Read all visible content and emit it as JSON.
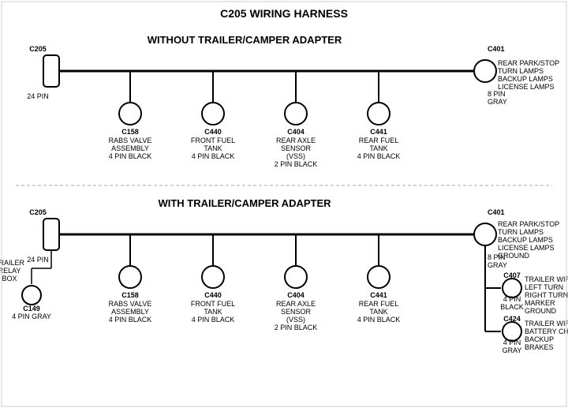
{
  "title": "C205 WIRING HARNESS",
  "section1": {
    "label": "WITHOUT TRAILER/CAMPER ADAPTER",
    "left_connector": {
      "name": "C205",
      "pins": "24 PIN"
    },
    "right_connector": {
      "name": "C401",
      "pins": "8 PIN",
      "color": "GRAY"
    },
    "right_labels": [
      "REAR PARK/STOP",
      "TURN LAMPS",
      "BACKUP LAMPS",
      "LICENSE LAMPS"
    ],
    "connectors": [
      {
        "name": "C158",
        "line1": "RABS VALVE",
        "line2": "ASSEMBLY",
        "line3": "4 PIN BLACK"
      },
      {
        "name": "C440",
        "line1": "FRONT FUEL",
        "line2": "TANK",
        "line3": "4 PIN BLACK"
      },
      {
        "name": "C404",
        "line1": "REAR AXLE",
        "line2": "SENSOR",
        "line3": "(VSS)",
        "line4": "2 PIN BLACK"
      },
      {
        "name": "C441",
        "line1": "REAR FUEL",
        "line2": "TANK",
        "line3": "4 PIN BLACK"
      }
    ]
  },
  "section2": {
    "label": "WITH TRAILER/CAMPER ADAPTER",
    "left_connector": {
      "name": "C205",
      "pins": "24 PIN"
    },
    "right_connector": {
      "name": "C401",
      "pins": "8 PIN",
      "color": "GRAY"
    },
    "right_labels": [
      "REAR PARK/STOP",
      "TURN LAMPS",
      "BACKUP LAMPS",
      "LICENSE LAMPS",
      "GROUND"
    ],
    "extra_left": {
      "relay": "TRAILER",
      "relay2": "RELAY",
      "relay3": "BOX",
      "name": "C149",
      "pins": "4 PIN GRAY"
    },
    "connectors": [
      {
        "name": "C158",
        "line1": "RABS VALVE",
        "line2": "ASSEMBLY",
        "line3": "4 PIN BLACK"
      },
      {
        "name": "C440",
        "line1": "FRONT FUEL",
        "line2": "TANK",
        "line3": "4 PIN BLACK"
      },
      {
        "name": "C404",
        "line1": "REAR AXLE",
        "line2": "SENSOR",
        "line3": "(VSS)",
        "line4": "2 PIN BLACK"
      },
      {
        "name": "C441",
        "line1": "REAR FUEL",
        "line2": "TANK",
        "line3": "4 PIN BLACK"
      }
    ],
    "right_connectors": [
      {
        "name": "C407",
        "pins": "4 PIN",
        "color": "BLACK",
        "labels": [
          "TRAILER WIRES",
          "LEFT TURN",
          "RIGHT TURN",
          "MARKER",
          "GROUND"
        ]
      },
      {
        "name": "C424",
        "pins": "4 PIN",
        "color": "GRAY",
        "labels": [
          "TRAILER WIRES",
          "BATTERY CHARGE",
          "BACKUP",
          "BRAKES"
        ]
      }
    ]
  }
}
